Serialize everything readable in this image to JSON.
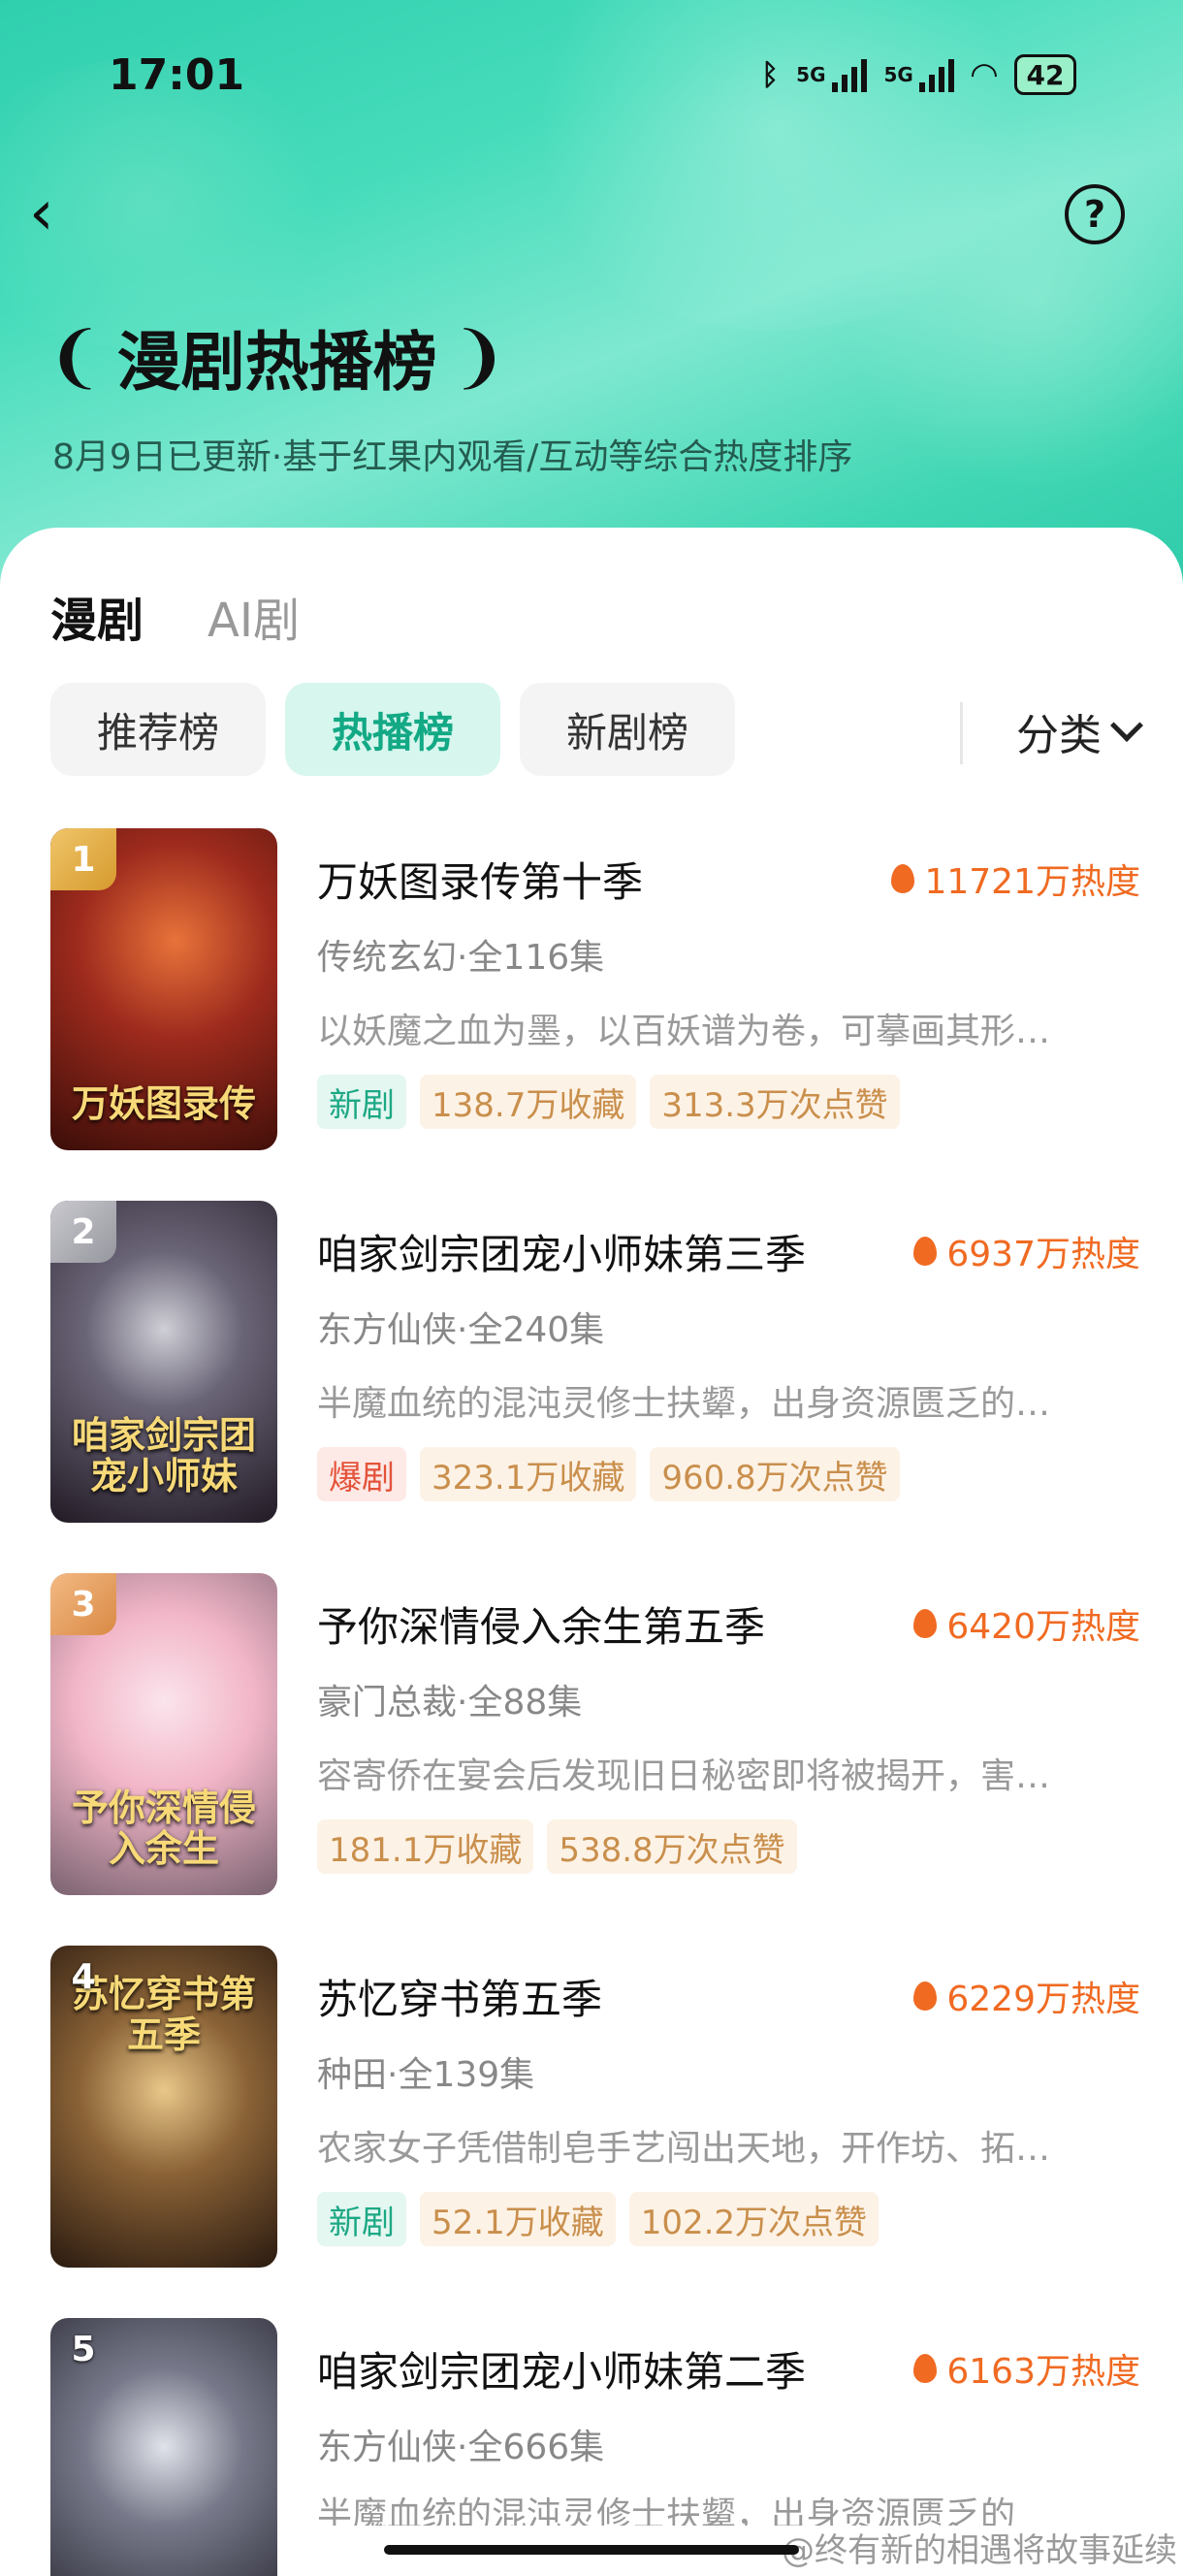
{
  "status_bar": {
    "time": "17:01",
    "net1": "5G",
    "net2": "5G",
    "battery": "42"
  },
  "header": {
    "title": "漫剧热播榜",
    "subtitle": "8月9日已更新·基于红果内观看/互动等综合热度排序"
  },
  "tabs": [
    {
      "label": "漫剧"
    },
    {
      "label": "AI剧"
    }
  ],
  "filters": {
    "pills": [
      {
        "label": "推荐榜"
      },
      {
        "label": "热播榜"
      },
      {
        "label": "新剧榜"
      }
    ],
    "category_label": "分类"
  },
  "items": [
    {
      "rank": "1",
      "name": "万妖图录传第十季",
      "heat": "11721万热度",
      "meta": "传统玄幻·全116集",
      "desc": "以妖魔之血为墨，以百妖谱为卷，可摹画其形…",
      "cover_title": "万妖图录传",
      "tags": [
        "新剧",
        "138.7万收藏",
        "313.3万次点赞"
      ]
    },
    {
      "rank": "2",
      "name": "咱家剑宗团宠小师妹第三季",
      "heat": "6937万热度",
      "meta": "东方仙侠·全240集",
      "desc": "半魔血统的混沌灵修士扶颦，出身资源匮乏的…",
      "cover_title": "咱家剑宗团宠小师妹",
      "tags": [
        "爆剧",
        "323.1万收藏",
        "960.8万次点赞"
      ]
    },
    {
      "rank": "3",
      "name": "予你深情侵入余生第五季",
      "heat": "6420万热度",
      "meta": "豪门总裁·全88集",
      "desc": "容寄侨在宴会后发现旧日秘密即将被揭开，害…",
      "cover_title": "予你深情侵入余生",
      "tags": [
        "181.1万收藏",
        "538.8万次点赞"
      ]
    },
    {
      "rank": "4",
      "name": "苏忆穿书第五季",
      "heat": "6229万热度",
      "meta": "种田·全139集",
      "desc": "农家女子凭借制皂手艺闯出天地，开作坊、拓…",
      "cover_title": "苏忆穿书第五季",
      "tags": [
        "新剧",
        "52.1万收藏",
        "102.2万次点赞"
      ]
    },
    {
      "rank": "5",
      "name": "咱家剑宗团宠小师妹第二季",
      "heat": "6163万热度",
      "meta": "东方仙侠·全666集",
      "desc": "半魔血统的混沌灵修士扶颦，出身资源匮乏的",
      "cover_title": "",
      "tags": []
    }
  ],
  "watermark": "@终有新的相遇将故事延续"
}
